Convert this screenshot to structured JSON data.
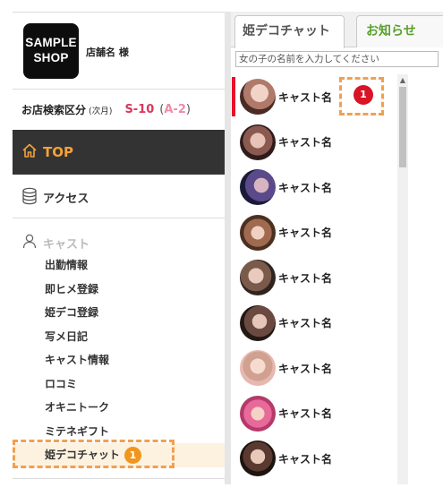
{
  "shop": {
    "logo_line1": "SAMPLE",
    "logo_line2": "SHOP",
    "name": "店舗名 様"
  },
  "search_category": {
    "label": "お店検索区分",
    "period": "(次月)",
    "code": "S-10",
    "sub_code": "A-2",
    "open_paren": "(",
    "close_paren": ")"
  },
  "nav": {
    "top_label": "TOP",
    "access_label": "アクセス",
    "cast_label": "キャスト",
    "submenu": [
      {
        "label": "出勤情報"
      },
      {
        "label": "即ヒメ登録"
      },
      {
        "label": "姫デコ登録"
      },
      {
        "label": "写メ日記"
      },
      {
        "label": "キャスト情報"
      },
      {
        "label": "ロコミ"
      },
      {
        "label": "オキニトーク"
      },
      {
        "label": "ミテネギフト"
      },
      {
        "label": "姫デコチャット",
        "badge": "1"
      }
    ]
  },
  "tabs": {
    "active": "姫デコチャット",
    "news": "お知らせ"
  },
  "search": {
    "placeholder": "女の子の名前を入力してください"
  },
  "cast_list": [
    {
      "name": "キャスト名",
      "unread": "1"
    },
    {
      "name": "キャスト名"
    },
    {
      "name": "キャスト名"
    },
    {
      "name": "キャスト名"
    },
    {
      "name": "キャスト名"
    },
    {
      "name": "キャスト名"
    },
    {
      "name": "キャスト名"
    },
    {
      "name": "キャスト名"
    },
    {
      "name": "キャスト名"
    }
  ],
  "colors": {
    "accent_orange": "#f2a23a",
    "unread_red": "#d81426",
    "code_pink": "#d9365a",
    "news_green": "#5aa02c"
  },
  "icons": {
    "top": "home-icon",
    "access": "database-icon",
    "cast": "person-icon"
  }
}
